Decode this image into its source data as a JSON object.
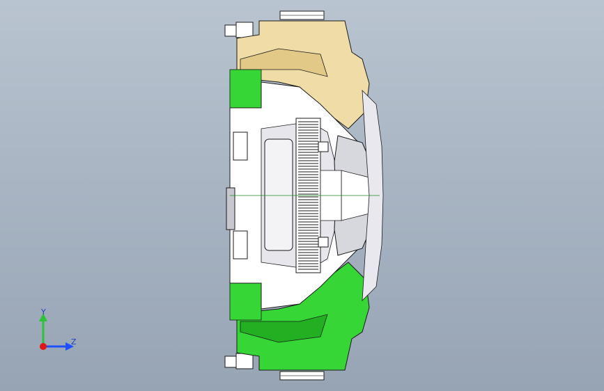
{
  "viewport": {
    "background_top": "#b9c4d0",
    "background_bottom": "#97a4b4"
  },
  "model": {
    "colors": {
      "upper_part": "#efdca7",
      "lower_part": "#35d635",
      "core": "#ffffff",
      "shade": "#c7c7cf",
      "edge": "#1a1a1a"
    }
  },
  "triad": {
    "y_label": "Y",
    "z_label": "Z",
    "colors": {
      "y": "#2fc13a",
      "z": "#1f4fff",
      "x": "#e01717"
    }
  }
}
